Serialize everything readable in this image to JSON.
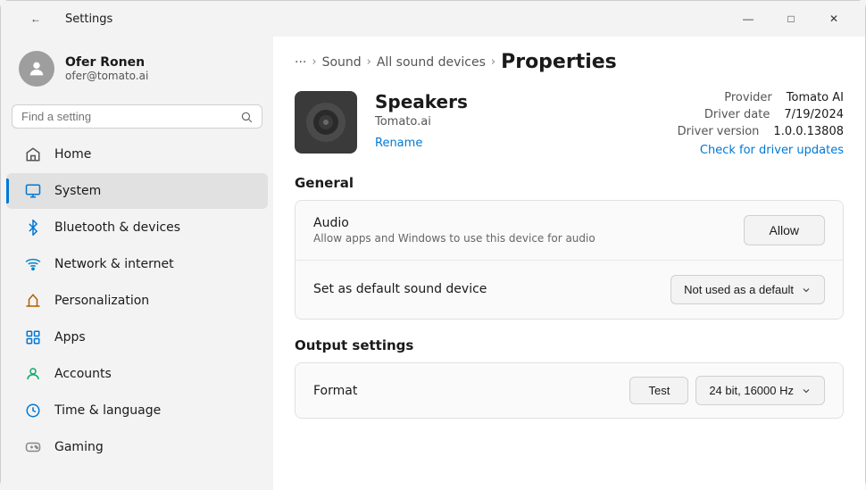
{
  "window": {
    "title": "Settings"
  },
  "titlebar": {
    "back_icon": "←",
    "title": "Settings",
    "minimize": "—",
    "maximize": "□",
    "close": "✕"
  },
  "sidebar": {
    "user": {
      "name": "Ofer Ronen",
      "email": "ofer@tomato.ai"
    },
    "search": {
      "placeholder": "Find a setting"
    },
    "nav_items": [
      {
        "id": "home",
        "icon": "home",
        "label": "Home",
        "active": false
      },
      {
        "id": "system",
        "icon": "system",
        "label": "System",
        "active": true
      },
      {
        "id": "bluetooth",
        "icon": "bluetooth",
        "label": "Bluetooth & devices",
        "active": false
      },
      {
        "id": "network",
        "icon": "network",
        "label": "Network & internet",
        "active": false
      },
      {
        "id": "personalization",
        "icon": "personalization",
        "label": "Personalization",
        "active": false
      },
      {
        "id": "apps",
        "icon": "apps",
        "label": "Apps",
        "active": false
      },
      {
        "id": "accounts",
        "icon": "accounts",
        "label": "Accounts",
        "active": false
      },
      {
        "id": "time",
        "icon": "time",
        "label": "Time & language",
        "active": false
      },
      {
        "id": "gaming",
        "icon": "gaming",
        "label": "Gaming",
        "active": false
      }
    ]
  },
  "breadcrumb": {
    "ellipsis": "···",
    "sound": "Sound",
    "all_sound_devices": "All sound devices",
    "current": "Properties",
    "sep": "›"
  },
  "device": {
    "name": "Speakers",
    "brand": "Tomato.ai",
    "rename_label": "Rename",
    "provider_label": "Provider",
    "provider_value": "Tomato AI",
    "driver_date_label": "Driver date",
    "driver_date_value": "7/19/2024",
    "driver_version_label": "Driver version",
    "driver_version_value": "1.0.0.13808",
    "driver_update_link": "Check for driver updates"
  },
  "general": {
    "section_title": "General",
    "audio_label": "Audio",
    "audio_desc": "Allow apps and Windows to use this device for audio",
    "allow_btn": "Allow",
    "default_label": "Set as default sound device",
    "default_dropdown": "Not used as a default"
  },
  "output": {
    "section_title": "Output settings",
    "format_label": "Format",
    "test_btn": "Test",
    "format_dropdown": "24 bit, 16000 Hz"
  }
}
